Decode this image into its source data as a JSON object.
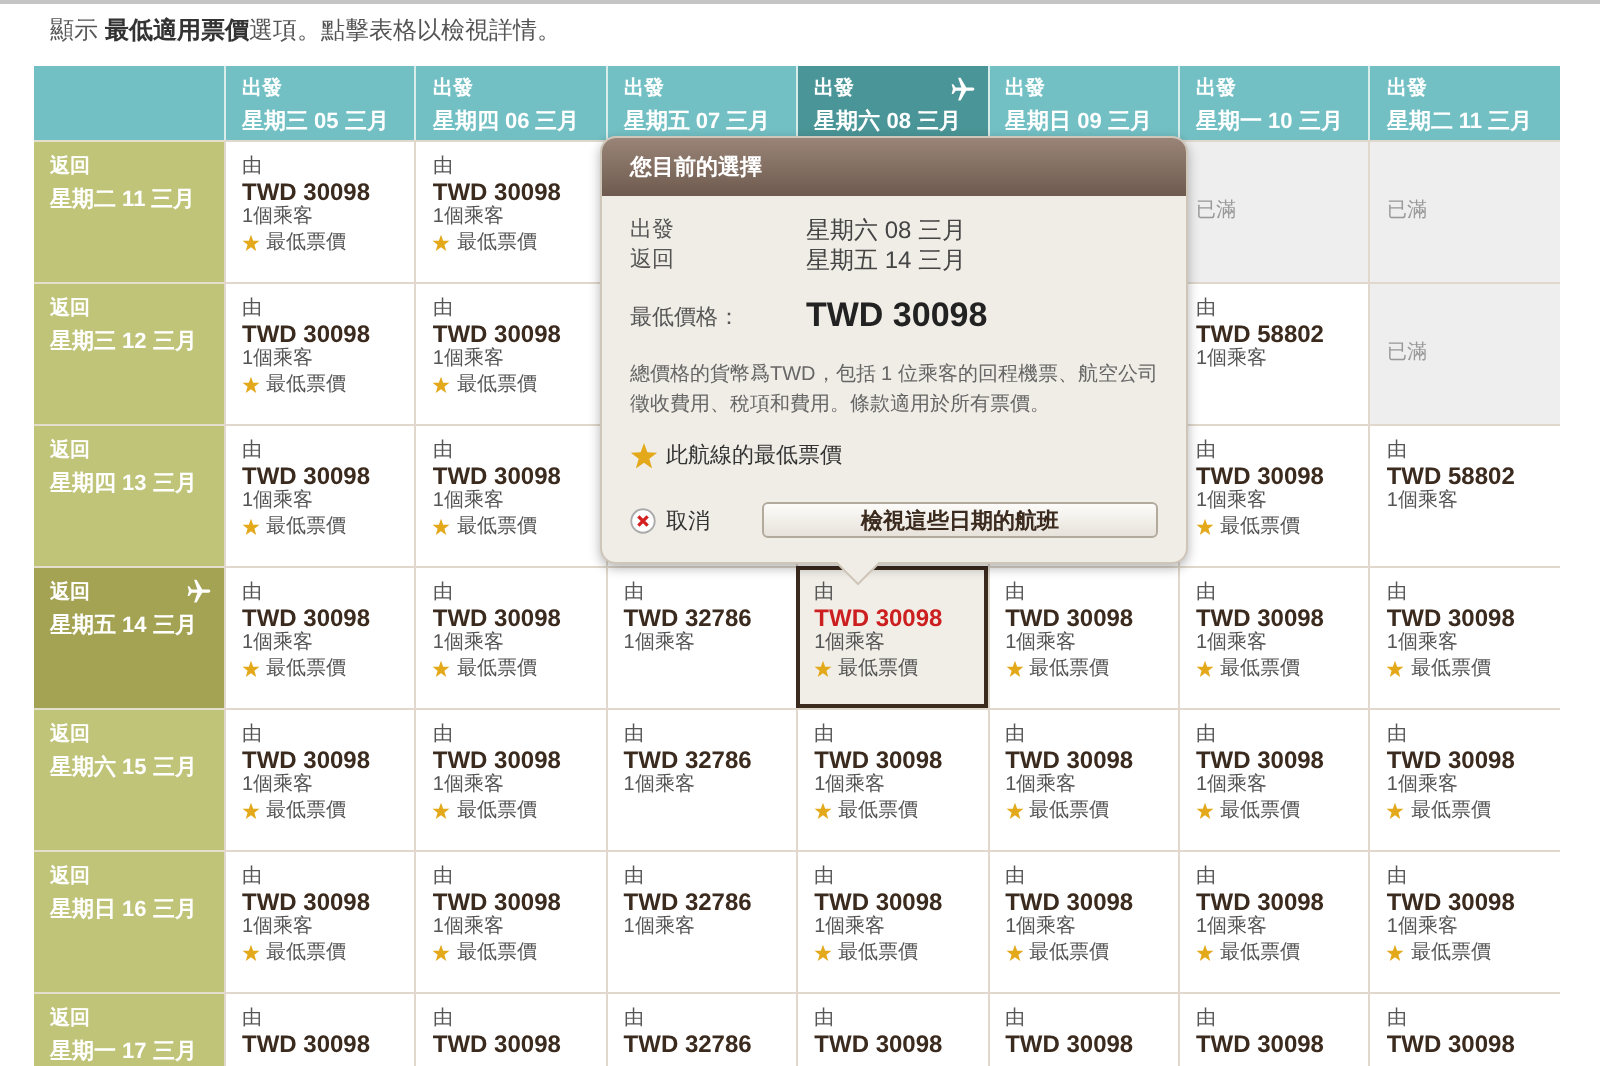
{
  "intro": "顯示 **最低適用票價**選項。點擊表格以檢視詳情。",
  "departures": [
    {
      "label": "出發",
      "date": "星期三 05 三月",
      "selected": false
    },
    {
      "label": "出發",
      "date": "星期四 06 三月",
      "selected": false
    },
    {
      "label": "出發",
      "date": "星期五 07 三月",
      "selected": false
    },
    {
      "label": "出發",
      "date": "星期六 08 三月",
      "selected": true
    },
    {
      "label": "出發",
      "date": "星期日 09 三月",
      "selected": false
    },
    {
      "label": "出發",
      "date": "星期一 10 三月",
      "selected": false
    },
    {
      "label": "出發",
      "date": "星期二 11 三月",
      "selected": false
    }
  ],
  "rows": [
    {
      "label": "返回",
      "date": "星期二 11 三月",
      "selected": false,
      "cells": [
        {
          "kind": "fare",
          "selected": false,
          "prefix": "由",
          "price": "TWD 30098",
          "passengers": "1個乘客",
          "best": "最低票價"
        },
        {
          "kind": "fare",
          "selected": false,
          "prefix": "由",
          "price": "TWD 30098",
          "passengers": "1個乘客",
          "best": "最低票價"
        },
        {
          "kind": "covered"
        },
        {
          "kind": "covered"
        },
        {
          "kind": "covered"
        },
        {
          "kind": "full",
          "text": "已滿"
        },
        {
          "kind": "full",
          "text": "已滿"
        }
      ]
    },
    {
      "label": "返回",
      "date": "星期三 12 三月",
      "selected": false,
      "cells": [
        {
          "kind": "fare",
          "selected": false,
          "prefix": "由",
          "price": "TWD 30098",
          "passengers": "1個乘客",
          "best": "最低票價"
        },
        {
          "kind": "fare",
          "selected": false,
          "prefix": "由",
          "price": "TWD 30098",
          "passengers": "1個乘客",
          "best": "最低票價"
        },
        {
          "kind": "covered"
        },
        {
          "kind": "covered"
        },
        {
          "kind": "covered"
        },
        {
          "kind": "fare",
          "selected": false,
          "prefix": "由",
          "price": "TWD 58802",
          "passengers": "1個乘客"
        },
        {
          "kind": "full",
          "text": "已滿"
        }
      ]
    },
    {
      "label": "返回",
      "date": "星期四 13 三月",
      "selected": false,
      "cells": [
        {
          "kind": "fare",
          "selected": false,
          "prefix": "由",
          "price": "TWD 30098",
          "passengers": "1個乘客",
          "best": "最低票價"
        },
        {
          "kind": "fare",
          "selected": false,
          "prefix": "由",
          "price": "TWD 30098",
          "passengers": "1個乘客",
          "best": "最低票價"
        },
        {
          "kind": "covered"
        },
        {
          "kind": "covered"
        },
        {
          "kind": "covered"
        },
        {
          "kind": "fare",
          "selected": false,
          "prefix": "由",
          "price": "TWD 30098",
          "passengers": "1個乘客",
          "best": "最低票價"
        },
        {
          "kind": "fare",
          "selected": false,
          "prefix": "由",
          "price": "TWD 58802",
          "passengers": "1個乘客"
        }
      ]
    },
    {
      "label": "返回",
      "date": "星期五 14 三月",
      "selected": true,
      "cells": [
        {
          "kind": "fare",
          "selected": false,
          "prefix": "由",
          "price": "TWD 30098",
          "passengers": "1個乘客",
          "best": "最低票價"
        },
        {
          "kind": "fare",
          "selected": false,
          "prefix": "由",
          "price": "TWD 30098",
          "passengers": "1個乘客",
          "best": "最低票價"
        },
        {
          "kind": "fare",
          "selected": false,
          "prefix": "由",
          "price": "TWD 32786",
          "passengers": "1個乘客"
        },
        {
          "kind": "fare",
          "selected": true,
          "prefix": "由",
          "price": "TWD 30098",
          "passengers": "1個乘客",
          "best": "最低票價"
        },
        {
          "kind": "fare",
          "selected": false,
          "prefix": "由",
          "price": "TWD 30098",
          "passengers": "1個乘客",
          "best": "最低票價"
        },
        {
          "kind": "fare",
          "selected": false,
          "prefix": "由",
          "price": "TWD 30098",
          "passengers": "1個乘客",
          "best": "最低票價"
        },
        {
          "kind": "fare",
          "selected": false,
          "prefix": "由",
          "price": "TWD 30098",
          "passengers": "1個乘客",
          "best": "最低票價"
        }
      ]
    },
    {
      "label": "返回",
      "date": "星期六 15 三月",
      "selected": false,
      "cells": [
        {
          "kind": "fare",
          "selected": false,
          "prefix": "由",
          "price": "TWD 30098",
          "passengers": "1個乘客",
          "best": "最低票價"
        },
        {
          "kind": "fare",
          "selected": false,
          "prefix": "由",
          "price": "TWD 30098",
          "passengers": "1個乘客",
          "best": "最低票價"
        },
        {
          "kind": "fare",
          "selected": false,
          "prefix": "由",
          "price": "TWD 32786",
          "passengers": "1個乘客"
        },
        {
          "kind": "fare",
          "selected": false,
          "prefix": "由",
          "price": "TWD 30098",
          "passengers": "1個乘客",
          "best": "最低票價"
        },
        {
          "kind": "fare",
          "selected": false,
          "prefix": "由",
          "price": "TWD 30098",
          "passengers": "1個乘客",
          "best": "最低票價"
        },
        {
          "kind": "fare",
          "selected": false,
          "prefix": "由",
          "price": "TWD 30098",
          "passengers": "1個乘客",
          "best": "最低票價"
        },
        {
          "kind": "fare",
          "selected": false,
          "prefix": "由",
          "price": "TWD 30098",
          "passengers": "1個乘客",
          "best": "最低票價"
        }
      ]
    },
    {
      "label": "返回",
      "date": "星期日 16 三月",
      "selected": false,
      "cells": [
        {
          "kind": "fare",
          "selected": false,
          "prefix": "由",
          "price": "TWD 30098",
          "passengers": "1個乘客",
          "best": "最低票價"
        },
        {
          "kind": "fare",
          "selected": false,
          "prefix": "由",
          "price": "TWD 30098",
          "passengers": "1個乘客",
          "best": "最低票價"
        },
        {
          "kind": "fare",
          "selected": false,
          "prefix": "由",
          "price": "TWD 32786",
          "passengers": "1個乘客"
        },
        {
          "kind": "fare",
          "selected": false,
          "prefix": "由",
          "price": "TWD 30098",
          "passengers": "1個乘客",
          "best": "最低票價"
        },
        {
          "kind": "fare",
          "selected": false,
          "prefix": "由",
          "price": "TWD 30098",
          "passengers": "1個乘客",
          "best": "最低票價"
        },
        {
          "kind": "fare",
          "selected": false,
          "prefix": "由",
          "price": "TWD 30098",
          "passengers": "1個乘客",
          "best": "最低票價"
        },
        {
          "kind": "fare",
          "selected": false,
          "prefix": "由",
          "price": "TWD 30098",
          "passengers": "1個乘客",
          "best": "最低票價"
        }
      ]
    },
    {
      "label": "返回",
      "date": "星期一 17 三月",
      "selected": false,
      "cells": [
        {
          "kind": "fare",
          "selected": false,
          "prefix": "由",
          "price": "TWD 30098"
        },
        {
          "kind": "fare",
          "selected": false,
          "prefix": "由",
          "price": "TWD 30098"
        },
        {
          "kind": "fare",
          "selected": false,
          "prefix": "由",
          "price": "TWD 32786"
        },
        {
          "kind": "fare",
          "selected": false,
          "prefix": "由",
          "price": "TWD 30098"
        },
        {
          "kind": "fare",
          "selected": false,
          "prefix": "由",
          "price": "TWD 30098"
        },
        {
          "kind": "fare",
          "selected": false,
          "prefix": "由",
          "price": "TWD 30098"
        },
        {
          "kind": "fare",
          "selected": false,
          "prefix": "由",
          "price": "TWD 30098"
        }
      ]
    }
  ],
  "popover": {
    "title": "您目前的選擇",
    "dates": [
      {
        "label": "出發",
        "value": "星期六 08 三月"
      },
      {
        "label": "返回",
        "value": "星期五 14 三月"
      }
    ],
    "price_label": "最低價格：",
    "price": "TWD 30098",
    "note": "總價格的貨幣爲TWD，包括 1 位乘客的回程機票、航空公司徵收費用、稅項和費用。條款適用於所有票價。",
    "legend": "此航線的最低票價",
    "cancel": "取消",
    "button": "檢視這些日期的航班"
  }
}
